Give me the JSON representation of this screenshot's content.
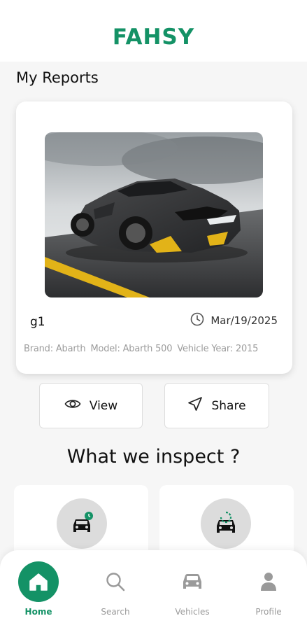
{
  "app": {
    "title": "FAHSY"
  },
  "reports": {
    "section_title": "My Reports",
    "items": [
      {
        "name": "g1",
        "date": "Mar/19/2025",
        "brand": "Brand: Abarth",
        "model": "Model: Abarth 500",
        "year": "Vehicle Year: 2015"
      }
    ],
    "actions": {
      "view_label": "View",
      "share_label": "Share"
    }
  },
  "inspect": {
    "title": "What we inspect ?"
  },
  "nav": {
    "items": [
      {
        "label": "Home",
        "icon": "home-icon",
        "active": true
      },
      {
        "label": "Search",
        "icon": "search-icon",
        "active": false
      },
      {
        "label": "Vehicles",
        "icon": "car-icon",
        "active": false
      },
      {
        "label": "Profile",
        "icon": "person-icon",
        "active": false
      }
    ]
  },
  "colors": {
    "accent": "#149266",
    "muted": "#9a9a9a"
  }
}
